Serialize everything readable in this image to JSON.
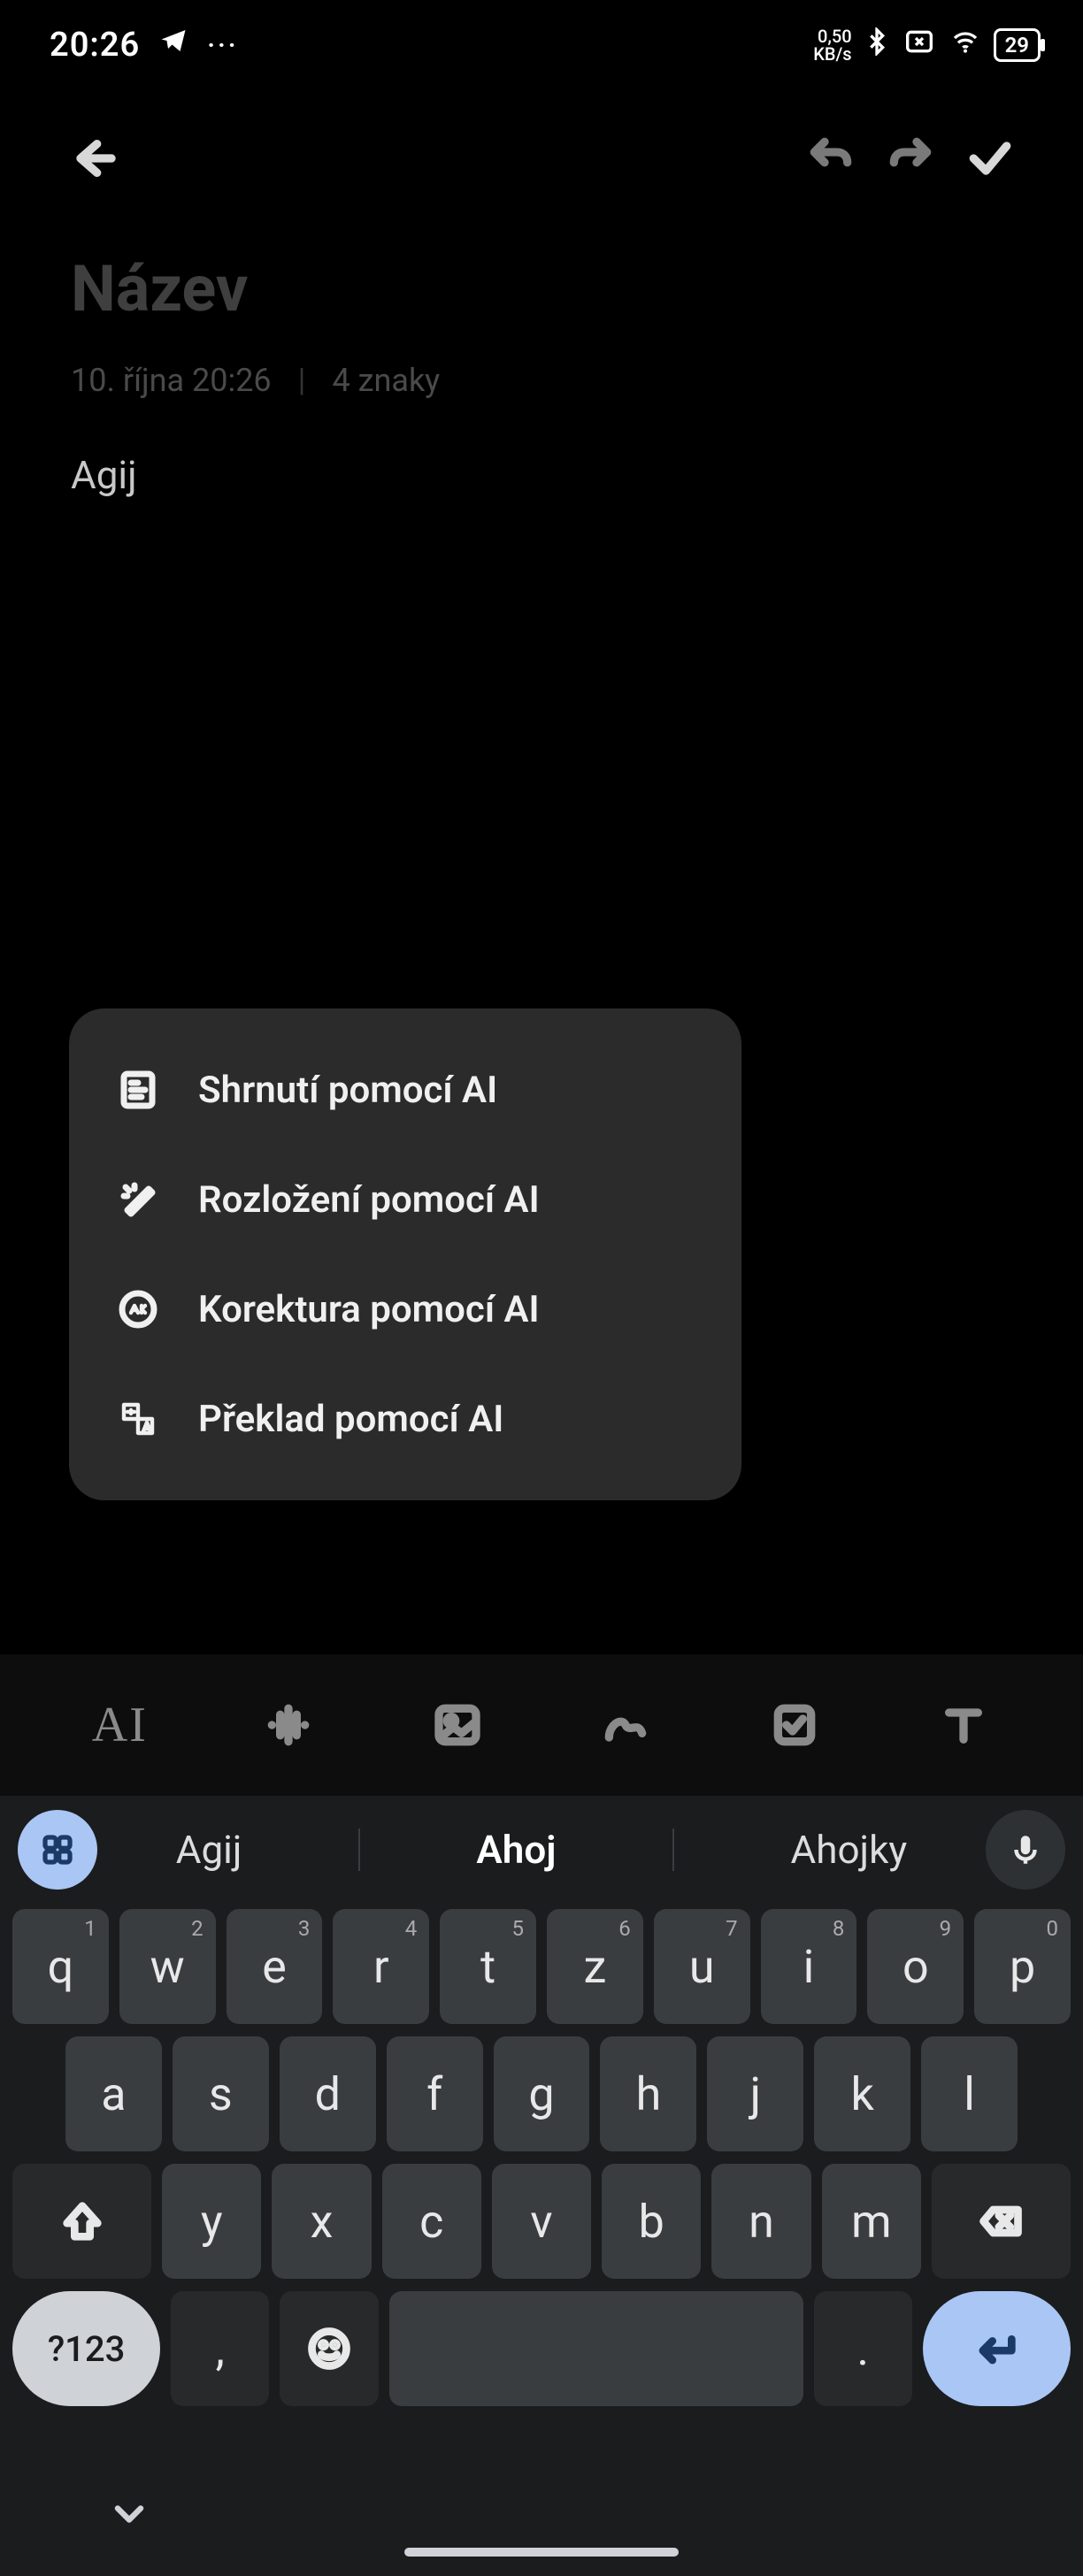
{
  "status": {
    "clock": "20:26",
    "kbs_top": "0,50",
    "kbs_bot": "KB/s",
    "battery": "29"
  },
  "note": {
    "title_placeholder": "Název",
    "date": "10. října 20:26",
    "char_count": "4 znaky",
    "content": "Agij"
  },
  "popup": {
    "items": [
      {
        "label": "Shrnutí pomocí AI"
      },
      {
        "label": "Rozložení pomocí AI"
      },
      {
        "label": "Korektura pomocí AI"
      },
      {
        "label": "Překlad pomocí AI"
      }
    ]
  },
  "toolbar": {
    "ai_label": "AI"
  },
  "keyboard": {
    "suggestions": [
      "Agij",
      "Ahoj",
      "Ahojky"
    ],
    "row1": [
      {
        "k": "q",
        "s": "1"
      },
      {
        "k": "w",
        "s": "2"
      },
      {
        "k": "e",
        "s": "3"
      },
      {
        "k": "r",
        "s": "4"
      },
      {
        "k": "t",
        "s": "5"
      },
      {
        "k": "z",
        "s": "6"
      },
      {
        "k": "u",
        "s": "7"
      },
      {
        "k": "i",
        "s": "8"
      },
      {
        "k": "o",
        "s": "9"
      },
      {
        "k": "p",
        "s": "0"
      }
    ],
    "row2": [
      "a",
      "s",
      "d",
      "f",
      "g",
      "h",
      "j",
      "k",
      "l"
    ],
    "row3": [
      "y",
      "x",
      "c",
      "v",
      "b",
      "n",
      "m"
    ],
    "mode_label": "?123",
    "comma": ",",
    "period": "."
  }
}
